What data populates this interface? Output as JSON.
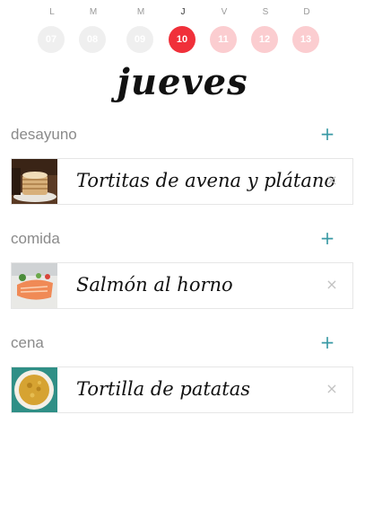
{
  "week": {
    "days": [
      {
        "letter": "L",
        "number": "07",
        "state": "past"
      },
      {
        "letter": "M",
        "number": "08",
        "state": "past"
      },
      {
        "letter": "M",
        "number": "09",
        "state": "past"
      },
      {
        "letter": "J",
        "number": "10",
        "state": "today"
      },
      {
        "letter": "V",
        "number": "11",
        "state": "future"
      },
      {
        "letter": "S",
        "number": "12",
        "state": "future"
      },
      {
        "letter": "D",
        "number": "13",
        "state": "future"
      }
    ]
  },
  "day_title": "jueves",
  "meals": [
    {
      "name": "desayuno",
      "add_icon": "+",
      "recipe": "Tortitas de avena y plátano",
      "thumb_icon": "pancakes-photo",
      "remove_icon": "×"
    },
    {
      "name": "comida",
      "add_icon": "+",
      "recipe": "Salmón al horno",
      "thumb_icon": "salmon-photo",
      "remove_icon": "×"
    },
    {
      "name": "cena",
      "add_icon": "+",
      "recipe": "Tortilla de patatas",
      "thumb_icon": "tortilla-photo",
      "remove_icon": "×"
    }
  ],
  "colors": {
    "today": "#f0303a",
    "future": "#fbcdd0",
    "past": "#efefef",
    "accent": "#3a9aa5"
  }
}
